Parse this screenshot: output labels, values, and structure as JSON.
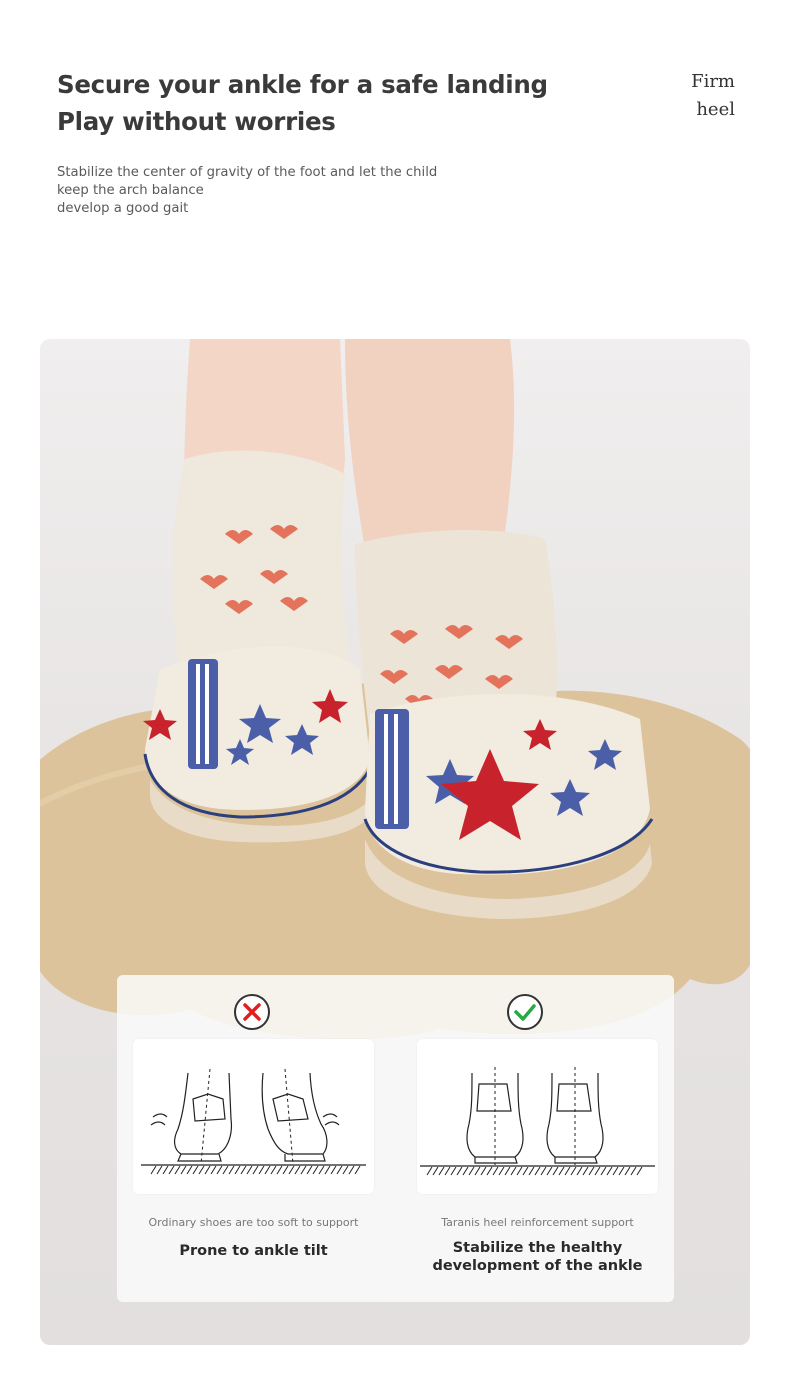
{
  "header": {
    "headline_line1": "Secure your ankle for a safe landing",
    "headline_line2": "Play without worries",
    "side_label_line1": "Firm",
    "side_label_line2": "heel",
    "description_lines": [
      "Stabilize the center of gravity of the foot and let the child",
      "keep the arch balance",
      "develop a good gait"
    ]
  },
  "comparison": {
    "bad": {
      "icon": "cross-icon",
      "color": "#e02020",
      "caption": "Ordinary shoes are too soft to support",
      "verdict": "Prone to ankle tilt"
    },
    "good": {
      "icon": "check-icon",
      "color": "#2aa845",
      "caption": "Taranis heel reinforcement support",
      "verdict_line1": "Stabilize the healthy",
      "verdict_line2": "development of the ankle"
    }
  },
  "colors": {
    "heading": "#3a3a3a",
    "mat": "#dcc39b",
    "sock": "#efe8dc",
    "heart": "#e4735c",
    "star_blue": "#4a5fa8",
    "star_red": "#c8232c"
  }
}
